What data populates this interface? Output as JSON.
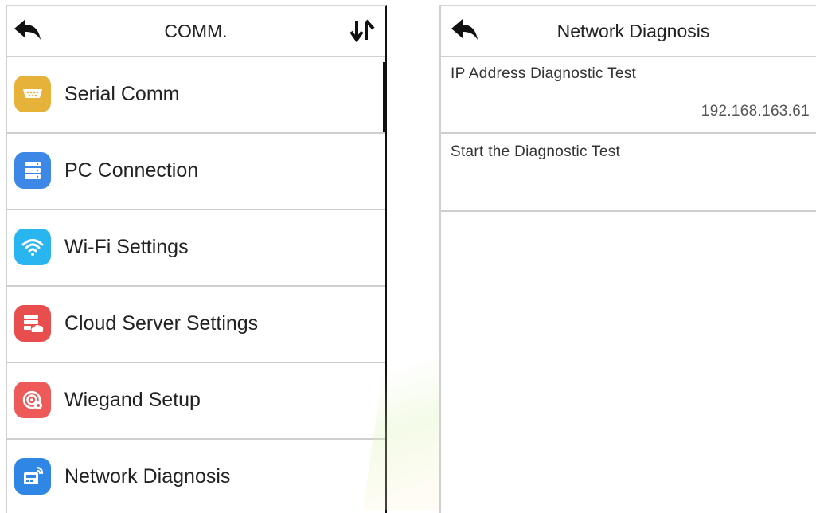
{
  "left": {
    "title": "COMM.",
    "back_icon": "back-arrow-icon",
    "sort_icon": "sort-arrows-icon",
    "items": [
      {
        "label": "Serial Comm",
        "icon": "serial-port-icon",
        "color": "#E7B23A"
      },
      {
        "label": "PC Connection",
        "icon": "server-stack-icon",
        "color": "#3D87E6"
      },
      {
        "label": "Wi-Fi Settings",
        "icon": "wifi-icon",
        "color": "#29B5EF"
      },
      {
        "label": "Cloud Server Settings",
        "icon": "cloud-server-icon",
        "color": "#E84E4E"
      },
      {
        "label": "Wiegand Setup",
        "icon": "wiegand-icon",
        "color": "#EE5A5A"
      },
      {
        "label": "Network Diagnosis",
        "icon": "network-diagnosis-icon",
        "color": "#2F86E5"
      }
    ]
  },
  "right": {
    "title": "Network Diagnosis",
    "back_icon": "back-arrow-icon",
    "rows": [
      {
        "label": "IP Address Diagnostic Test",
        "value": "192.168.163.61"
      },
      {
        "label": "Start the Diagnostic Test",
        "value": ""
      }
    ]
  }
}
